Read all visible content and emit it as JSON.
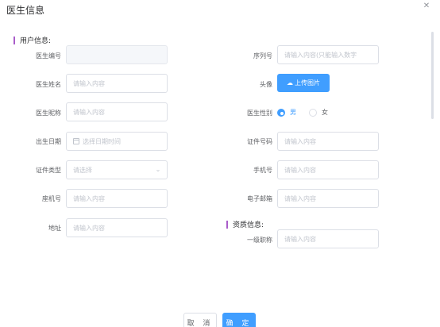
{
  "dialog": {
    "title": "医生信息",
    "close_icon": "close-icon"
  },
  "sections": {
    "user_info": "用户信息:",
    "qualification_info": "资质信息:"
  },
  "fields": {
    "doctor_id": {
      "label": "医生编号",
      "value": ""
    },
    "serial": {
      "label": "序列号",
      "placeholder": "请输入内容(只能输入数字"
    },
    "doctor_name": {
      "label": "医生姓名",
      "placeholder": "请输入内容"
    },
    "avatar": {
      "label": "头像",
      "button": "上传图片",
      "icon": "upload-cloud-icon"
    },
    "nickname": {
      "label": "医生昵称",
      "placeholder": "请输入内容"
    },
    "gender": {
      "label": "医生性别",
      "options": [
        "男",
        "女"
      ],
      "selected": "男"
    },
    "birth_date": {
      "label": "出生日期",
      "placeholder": "选择日期时间",
      "icon": "calendar-icon"
    },
    "id_number": {
      "label": "证件号码",
      "placeholder": "请输入内容"
    },
    "id_type": {
      "label": "证件类型",
      "placeholder": "请选择",
      "icon": "chevron-down-icon"
    },
    "mobile": {
      "label": "手机号",
      "placeholder": "请输入内容"
    },
    "landline": {
      "label": "座机号",
      "placeholder": "请输入内容"
    },
    "email": {
      "label": "电子邮箱",
      "placeholder": "请输入内容"
    },
    "address": {
      "label": "地址",
      "placeholder": "请输入内容"
    },
    "title_level1": {
      "label": "一级职称",
      "placeholder": "请输入内容"
    }
  },
  "footer": {
    "cancel": "取 消",
    "ok": "确 定"
  },
  "colors": {
    "primary": "#409eff",
    "section_bar": "#a95cc9",
    "border": "#dcdfe6"
  }
}
